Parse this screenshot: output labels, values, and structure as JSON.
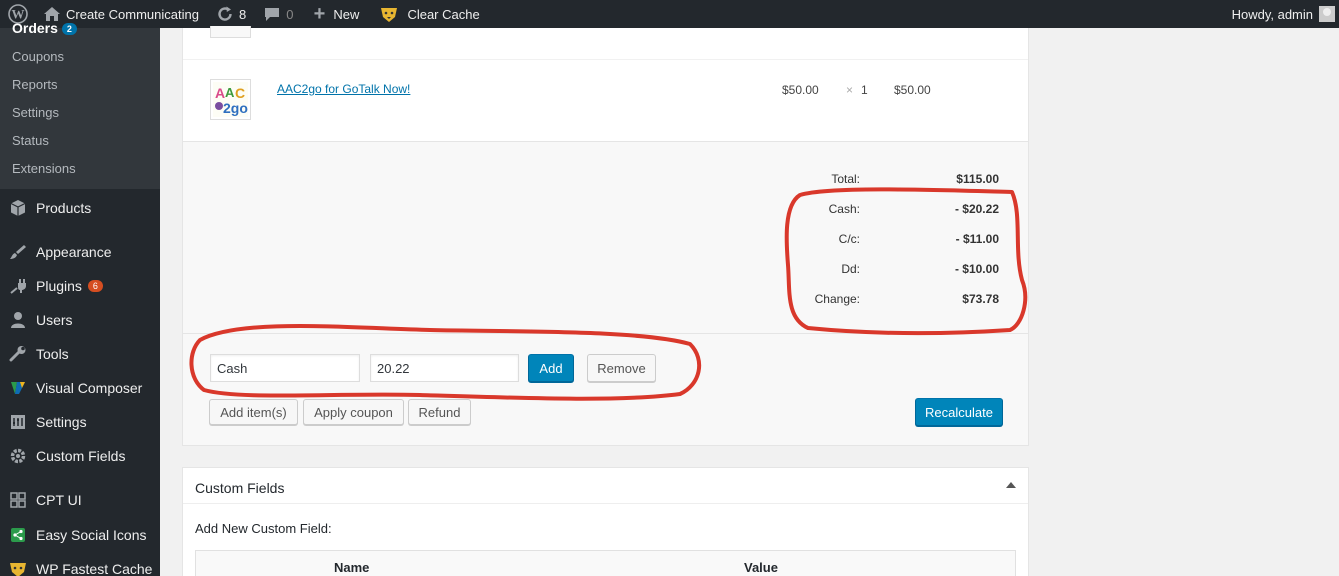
{
  "adminbar": {
    "site_name": "Create Communicating",
    "updates_count": "8",
    "comments_count": "0",
    "new_label": "New",
    "clear_cache_label": "Clear Cache",
    "howdy": "Howdy, admin"
  },
  "sidebar": {
    "orders_label": "Orders",
    "orders_badge": "2",
    "submenu": [
      "Coupons",
      "Reports",
      "Settings",
      "Status",
      "Extensions"
    ],
    "items": [
      {
        "label": "Products",
        "icon": "products-icon"
      },
      {
        "label": "Appearance",
        "icon": "paintbrush-icon"
      },
      {
        "label": "Plugins",
        "icon": "plugin-icon",
        "badge": "6"
      },
      {
        "label": "Users",
        "icon": "user-icon"
      },
      {
        "label": "Tools",
        "icon": "wrench-icon"
      },
      {
        "label": "Visual Composer",
        "icon": "vc-icon"
      },
      {
        "label": "Settings",
        "icon": "settings-icon"
      },
      {
        "label": "Custom Fields",
        "icon": "gear-icon"
      },
      {
        "label": "CPT UI",
        "icon": "grid-icon"
      },
      {
        "label": "Easy Social Icons",
        "icon": "share-icon"
      },
      {
        "label": "WP Fastest Cache",
        "icon": "cheetah-icon"
      }
    ]
  },
  "order_item": {
    "name": "AAC2go for GoTalk Now!",
    "thumb_text": "AAC2go",
    "cost": "$50.00",
    "qty_sep": "×",
    "qty": "1",
    "total": "$50.00"
  },
  "totals": [
    {
      "label": "Total:",
      "value": "$115.00"
    },
    {
      "label": "Cash:",
      "value": "- $20.22"
    },
    {
      "label": "C/c:",
      "value": "- $11.00"
    },
    {
      "label": "Dd:",
      "value": "- $10.00"
    },
    {
      "label": "Change:",
      "value": "$73.78"
    }
  ],
  "payment_form": {
    "method_value": "Cash",
    "amount_value": "20.22",
    "add_label": "Add",
    "remove_label": "Remove"
  },
  "actions": {
    "add_items": "Add item(s)",
    "apply_coupon": "Apply coupon",
    "refund": "Refund",
    "recalculate": "Recalculate"
  },
  "custom_fields": {
    "title": "Custom Fields",
    "add_new": "Add New Custom Field:",
    "col_name": "Name",
    "col_value": "Value"
  },
  "colors": {
    "annotation": "#d9382b",
    "primary": "#0085ba"
  }
}
